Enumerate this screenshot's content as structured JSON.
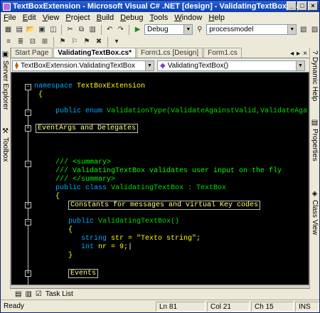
{
  "title": "TextBoxExtension - Microsoft Visual C# .NET [design] - ValidatingTextBox.cs*",
  "menu": [
    "File",
    "Edit",
    "View",
    "Project",
    "Build",
    "Debug",
    "Tools",
    "Window",
    "Help"
  ],
  "toolbar": {
    "config": "Debug",
    "find": "processmodel"
  },
  "left_panel": {
    "server_explorer": "Server Explorer",
    "toolbox": "Toolbox"
  },
  "right_panel": {
    "dynamic_help": "Dynamic Help",
    "properties": "Properties",
    "class_view": "Class View"
  },
  "tabs": [
    "Start Page",
    "ValidatingTextBox.cs*",
    "Form1.cs [Design]",
    "Form1.cs"
  ],
  "navbar": {
    "class_combo": "TextBoxExtension.ValidatingTextBox",
    "member_combo": "ValidatingTextBox()"
  },
  "code": {
    "ns_kw": "namespace",
    "ns_name": " TextBoxExtension",
    "brace_open": "{",
    "enum_line_kw": "public enum",
    "enum_rest": " ValidationType(ValidateAgainstValid,ValidateAga",
    "region1": "EventArgs and Delegates",
    "c1": "/// <summary>",
    "c2": "/// ValidatingTextBox validates user input on the fly",
    "c3": "/// </summary>",
    "class_kw": "public class",
    "class_rest": " ValidatingTextBox : TextBox",
    "brace2": "{",
    "region2": "Constants for messages and virtual Key codes",
    "ctor_kw": "public",
    "ctor_rest": " ValidatingTextBox()",
    "brace3": "{",
    "str_kw": "string",
    "str_rest": " str = ",
    "str_val": "\"Texto string\"",
    "str_end": ";",
    "int_kw": "int",
    "int_rest": " nr = 9;",
    "brace4": "}",
    "region3": "Events"
  },
  "bottom": {
    "task_list": "Task List"
  },
  "status": {
    "ready": "Ready",
    "ln": "Ln 81",
    "col": "Col 21",
    "ch": "Ch 15",
    "ins": "INS"
  }
}
